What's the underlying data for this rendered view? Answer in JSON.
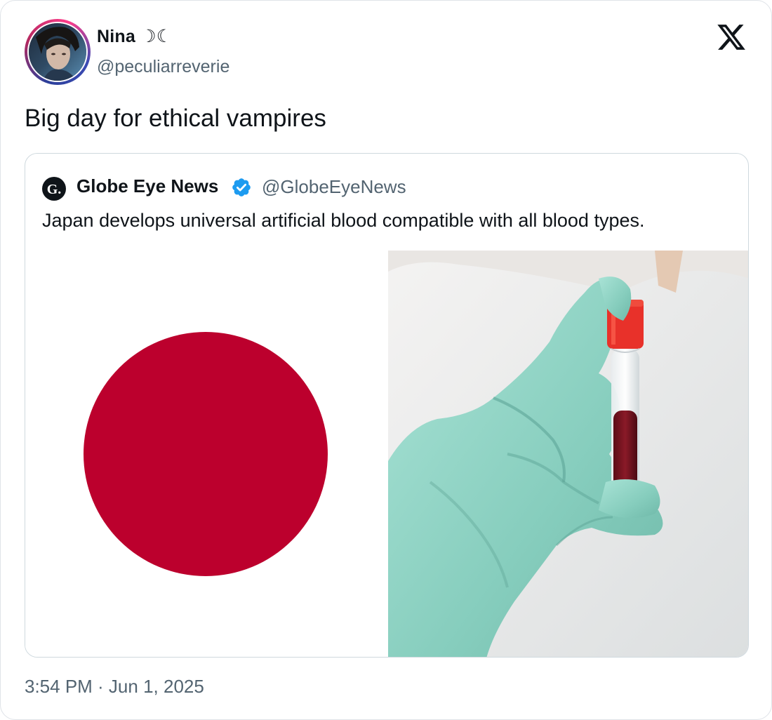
{
  "tweet": {
    "author_name": "Nina ☽☾",
    "author_handle": "@peculiarreverie",
    "text": "Big day for ethical vampires",
    "timestamp": "3:54 PM · Jun 1, 2025"
  },
  "quoted_tweet": {
    "logo_letter": "G.",
    "author_name": "Globe Eye News",
    "author_handle": "@GlobeEyeNews",
    "verified": true,
    "text": "Japan develops universal artificial blood compatible with all blood types."
  },
  "colors": {
    "flag_red": "#bc002d",
    "verified_blue": "#1d9bf0",
    "secondary_text": "#536471",
    "glove": "#8fd6c6",
    "tube_cap": "#e8312a",
    "blood": "#6e0f1c"
  },
  "icons": {
    "brand": "x-logo-icon",
    "verified": "verified-badge-icon"
  }
}
